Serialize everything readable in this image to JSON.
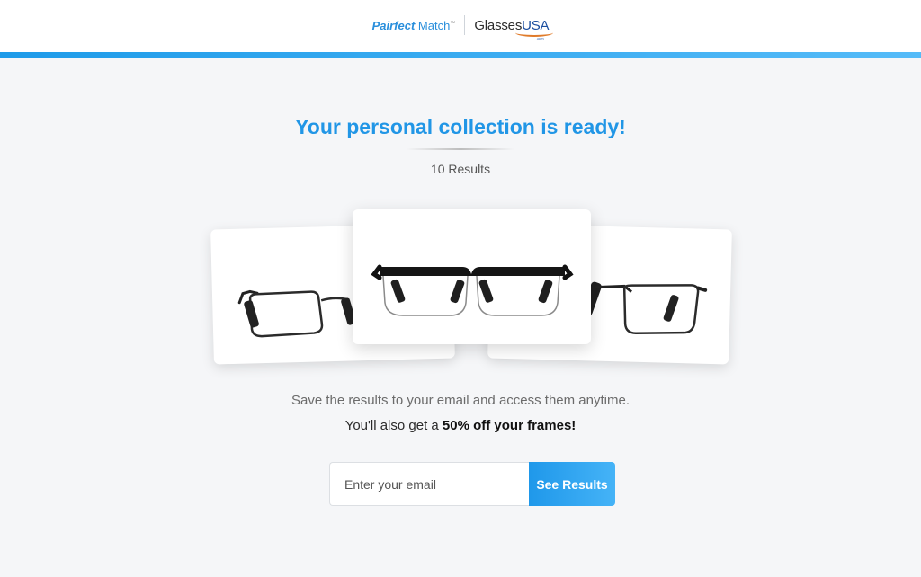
{
  "header": {
    "pairfect_bold": "Pairfect",
    "pairfect_rest": " Match",
    "pairfect_tm": "™",
    "glasses_text": "Glasses",
    "usa_text": "USA",
    "dotcom_text": ".com"
  },
  "main": {
    "title": "Your personal collection is ready!",
    "results_count": "10 Results",
    "save_text": "Save the results to your email and access them anytime.",
    "offer_prefix": "You'll also get a ",
    "offer_bold": "50% off your frames!"
  },
  "products": [
    {
      "name": "rectangle-frame-left"
    },
    {
      "name": "semi-rimless-frame-center"
    },
    {
      "name": "rectangle-frame-right"
    }
  ],
  "form": {
    "email_placeholder": "Enter your email",
    "email_value": "",
    "button_label": "See Results"
  },
  "colors": {
    "accent_blue": "#2196e6",
    "button_blue": "#1f98ea",
    "background": "#f5f6f8"
  }
}
